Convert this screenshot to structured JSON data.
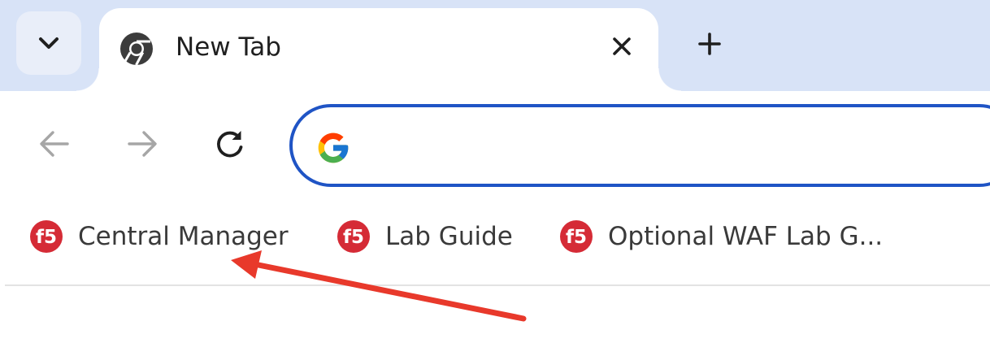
{
  "tab_strip": {
    "active_tab": {
      "title": "New Tab",
      "favicon": "chrome-icon"
    },
    "tab_search_icon": "chevron-down-icon",
    "close_icon": "close-icon",
    "new_tab_icon": "plus-icon"
  },
  "toolbar": {
    "back_icon": "arrow-left-icon",
    "forward_icon": "arrow-right-icon",
    "reload_icon": "reload-icon",
    "omnibox": {
      "icon": "google-g-icon",
      "value": "",
      "accent_color": "#1f54c5"
    }
  },
  "bookmarks": [
    {
      "label": "Central Manager",
      "icon": "f5-logo-icon"
    },
    {
      "label": "Lab Guide",
      "icon": "f5-logo-icon"
    },
    {
      "label": "Optional WAF Lab G...",
      "icon": "f5-logo-icon"
    }
  ],
  "annotation": {
    "type": "arrow",
    "color": "#e8392b",
    "points_to": "Central Manager"
  },
  "colors": {
    "tabstrip_bg": "#d8e3f7",
    "f5_red": "#d52b36"
  }
}
